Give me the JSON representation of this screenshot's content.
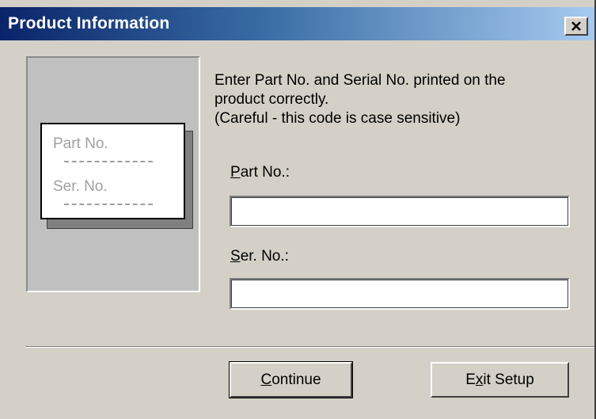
{
  "window": {
    "title": "Product Information",
    "close_icon": "close-icon"
  },
  "art": {
    "part_label": "Part No.",
    "serial_label": "Ser. No."
  },
  "instructions": {
    "line1": "Enter Part No. and Serial No. printed on the",
    "line2": "product correctly.",
    "line3": "(Careful - this code is case sensitive)"
  },
  "part_field": {
    "label_mnemonic": "P",
    "label_rest": "art No.:",
    "value": ""
  },
  "serial_field": {
    "label_mnemonic": "S",
    "label_rest": "er. No.:",
    "value": ""
  },
  "buttons": {
    "continue_mnemonic": "C",
    "continue_rest": "ontinue",
    "exit_pre": "E",
    "exit_mnemonic": "x",
    "exit_rest": "it Setup"
  },
  "colors": {
    "titlebar_start": "#0a246a",
    "titlebar_end": "#a6caf0",
    "window_bg": "#d4d0c8"
  }
}
